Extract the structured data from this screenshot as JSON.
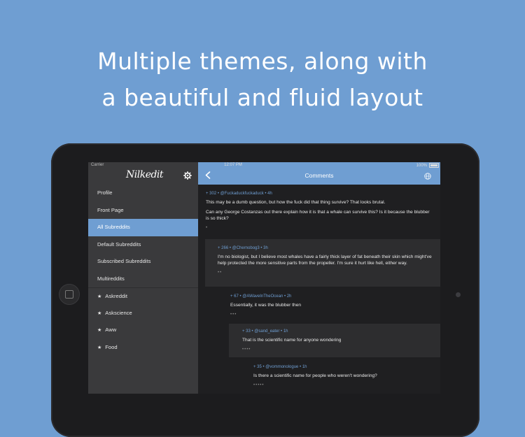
{
  "headline": {
    "line1": "Multiple themes, along with",
    "line2": "a beautiful and fluid layout"
  },
  "status_bar": {
    "carrier": "Carrier",
    "time": "12:07 PM",
    "battery": "100%"
  },
  "sidebar": {
    "logo": "Nilkedit",
    "settings_icon": "gear-icon",
    "items": [
      {
        "label": "Profile"
      },
      {
        "label": "Front Page"
      },
      {
        "label": "All Subreddits"
      },
      {
        "label": "Default Subreddits"
      },
      {
        "label": "Subscribed Subreddits"
      },
      {
        "label": "Multireddits"
      },
      {
        "label": "Askreddit"
      },
      {
        "label": "Askscience"
      },
      {
        "label": "Aww"
      },
      {
        "label": "Food"
      }
    ],
    "active_item": "All Subreddits",
    "star_glyph": "★"
  },
  "navbar": {
    "title": "Comments",
    "back_icon": "chevron-left-icon",
    "globe_icon": "globe-icon"
  },
  "comments": [
    {
      "meta": "+ 302 • @Fuckaduckfuckaduck • 4h",
      "body1": "This may be a dumb question, but how the fuck did that thing survive? That looks brutal.",
      "body2": "Can any George Costanzas out there explain how it is that a whale can survive this? Is it because the blubber is so thick?",
      "dots": "•"
    },
    {
      "meta": "+ 266 • @Chernobog3 • 3h",
      "body1": "I'm no biologist, but I believe most whales have a fairly thick layer of fat beneath their skin which might've help protected the more sensitive parts from the propeller. I'm sure it hurt like hell, either way.",
      "dots": "••"
    },
    {
      "meta": "+ 67 • @AWaveInTheOcean • 2h",
      "body1": "Essentially, it was the blubber then",
      "dots": "•••"
    },
    {
      "meta": "+ 33 • @sand_eater • 1h",
      "body1": "That is the scientific name for anyone wondering",
      "dots": "••••"
    },
    {
      "meta": "+ 35 • @vommonologue • 1h",
      "body1": "Is there a scientific name for people who weren't wondering?",
      "dots": "•••••"
    }
  ],
  "colors": {
    "accent": "#6f9ed2",
    "background": "#6f9ed2",
    "sidebar": "#3a3a3c",
    "panel_dark": "#1f1f21",
    "panel_alt": "#2d2d2f"
  }
}
